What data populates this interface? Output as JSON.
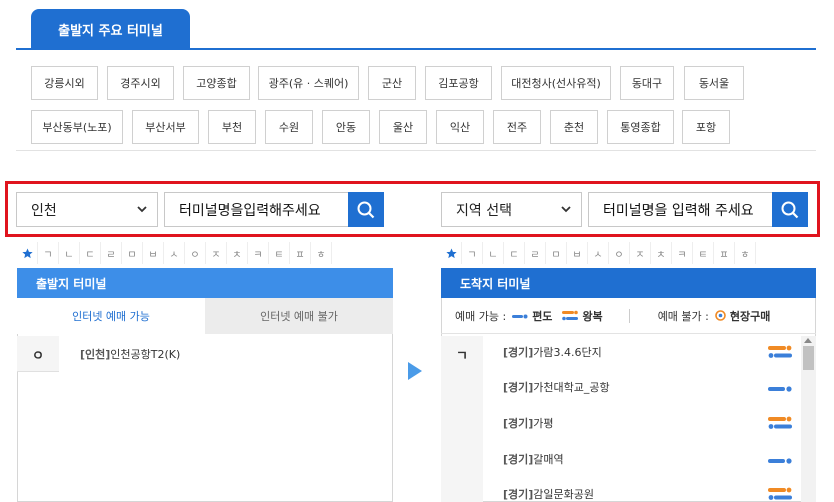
{
  "header": {
    "tab_label": "출발지 주요 터미널"
  },
  "terminals_row1": [
    "강릉시외",
    "경주시외",
    "고양종합",
    "광주(유 · 스퀘어)",
    "군산",
    "김포공항",
    "대전청사(선사유적)",
    "동대구",
    "동서울"
  ],
  "terminals_row2": [
    "부산동부(노포)",
    "부산서부",
    "부천",
    "수원",
    "안동",
    "울산",
    "익산",
    "전주",
    "춘천",
    "통영종합",
    "포항"
  ],
  "departure_search": {
    "region": "인천",
    "input_text": "터미널명을입력해주세요"
  },
  "arrival_search": {
    "region": "지역 선택",
    "input_text": "터미널명을 입력해 주세요"
  },
  "consonants": [
    "ㄱ",
    "ㄴ",
    "ㄷ",
    "ㄹ",
    "ㅁ",
    "ㅂ",
    "ㅅ",
    "ㅇ",
    "ㅈ",
    "ㅊ",
    "ㅋ",
    "ㅌ",
    "ㅍ",
    "ㅎ"
  ],
  "departure_panel": {
    "title": "출발지 터미널",
    "tab_online": "인터넷 예매 가능",
    "tab_offline": "인터넷 예매 불가",
    "group_letter": "ㅇ",
    "items": [
      {
        "region": "[인천]",
        "name": "인천공항T2(K)"
      }
    ]
  },
  "arrival_panel": {
    "title": "도착지 터미널",
    "legend_bookable": "예매 가능 :",
    "legend_oneway": "편도",
    "legend_roundtrip": "왕복",
    "legend_unbookable": "예매 불가 :",
    "legend_onsite": "현장구매",
    "group_letter": "ㄱ",
    "items": [
      {
        "region": "[경기]",
        "name": "가람3.4.6단지",
        "type": "round"
      },
      {
        "region": "[경기]",
        "name": "가천대학교_공항",
        "type": "oneway"
      },
      {
        "region": "[경기]",
        "name": "가평",
        "type": "round"
      },
      {
        "region": "[경기]",
        "name": "갈매역",
        "type": "oneway"
      },
      {
        "region": "[경기]",
        "name": "감일문화공원",
        "type": "round"
      }
    ]
  },
  "colors": {
    "primary": "#1f6fd1",
    "panel_head": "#3d8ee8",
    "highlight": "#e0141e",
    "orange": "#f08a24"
  }
}
